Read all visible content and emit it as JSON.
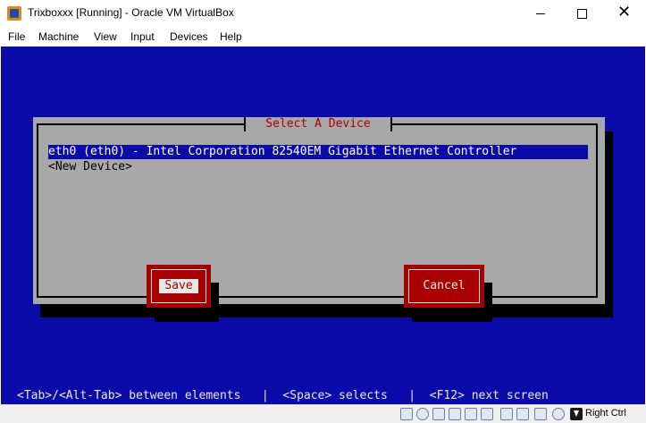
{
  "window": {
    "title": "Trixboxxx [Running] - Oracle VM VirtualBox"
  },
  "menu": {
    "items": [
      "File",
      "Machine",
      "View",
      "Input",
      "Devices",
      "Help"
    ]
  },
  "dialog": {
    "title": "Select A Device",
    "devices": [
      "eth0 (eth0) - Intel Corporation 82540EM Gigabit Ethernet Controller",
      "<New Device>"
    ],
    "selected_index": 0,
    "save_label": "Save",
    "cancel_label": "Cancel",
    "focused_button": "Save"
  },
  "hint": "<Tab>/<Alt-Tab> between elements   |  <Space> selects   |  <F12> next screen",
  "statusbar": {
    "host_key": "Right Ctrl",
    "icons": [
      "hard-disk-icon",
      "optical-drive-icon",
      "audio-icon",
      "network-icon",
      "usb-icon",
      "shared-folders-icon",
      "display-icon",
      "video-capture-icon",
      "cpu-icon",
      "mouse-integration-icon",
      "host-key-icon"
    ]
  },
  "colors": {
    "vm_background": "#0b0baa",
    "dialog": "#a8a8a8",
    "accent_red": "#a80000"
  }
}
